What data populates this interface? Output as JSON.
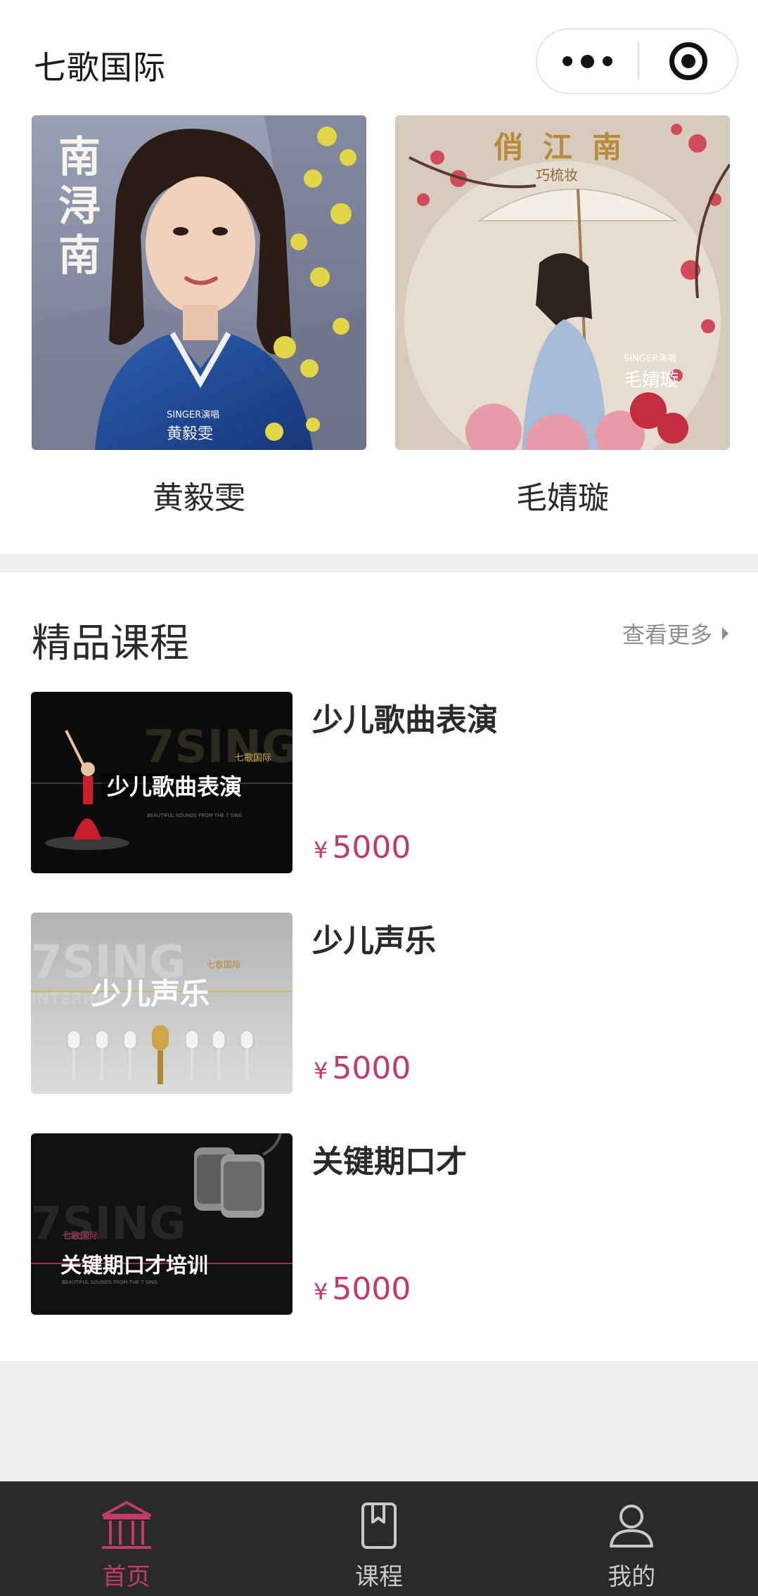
{
  "header": {
    "title": "七歌国际",
    "capsule": {
      "more_icon": "more-dots-icon",
      "close_icon": "target-icon"
    }
  },
  "singers": [
    {
      "name": "黄毅雯",
      "cover_text": "南浔南",
      "badge_small": "SINGER演唱",
      "badge_name": "黄毅雯"
    },
    {
      "name": "毛婧璇",
      "cover_text": "俏江南",
      "cover_sub": "巧梳妆",
      "badge_small": "SINGER演唱",
      "badge_name": "毛婧璇"
    }
  ],
  "courses": {
    "title": "精品课程",
    "see_more": "查看更多",
    "items": [
      {
        "name": "少儿歌曲表演",
        "currency": "¥",
        "price": "5000",
        "thumb_title": "少儿歌曲表演",
        "thumb_brand": "7SING",
        "thumb_logo": "七歌国际"
      },
      {
        "name": "少儿声乐",
        "currency": "¥",
        "price": "5000",
        "thumb_title": "少儿声乐",
        "thumb_brand": "7SING",
        "thumb_logo": "七歌国际"
      },
      {
        "name": "关键期口才",
        "currency": "¥",
        "price": "5000",
        "thumb_title": "关键期口才培训",
        "thumb_brand": "7SING",
        "thumb_logo": "七歌国际"
      }
    ]
  },
  "tabbar": {
    "items": [
      {
        "label": "首页",
        "icon": "home-building-icon",
        "active": true
      },
      {
        "label": "课程",
        "icon": "book-icon",
        "active": false
      },
      {
        "label": "我的",
        "icon": "user-icon",
        "active": false
      }
    ]
  },
  "colors": {
    "accent": "#c23a6c",
    "tabbar_bg": "#2a2a2c",
    "page_bg": "#efefef"
  }
}
